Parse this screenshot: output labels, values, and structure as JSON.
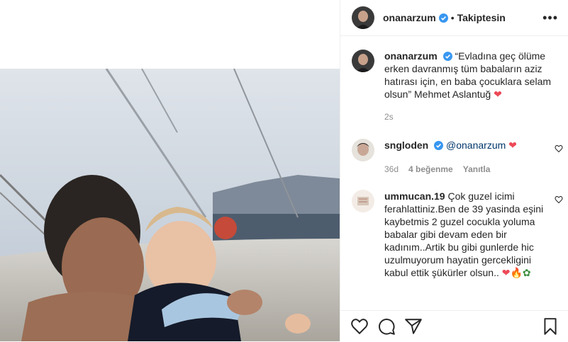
{
  "header": {
    "username": "onanarzum",
    "separator": "•",
    "follow_label": "Takiptesin",
    "more_label": "•••"
  },
  "caption": {
    "username": "onanarzum",
    "text": "“Evladına geç ölüme erken davranmış tüm babaların aziz hatırası için, en baba çocuklara selam olsun” Mehmet Aslantuğ",
    "time": "2s"
  },
  "comments": [
    {
      "username": "sngloden",
      "text": "@onanarzum",
      "time": "36d",
      "likes": "4 beğenme",
      "reply": "Yanıtla"
    },
    {
      "username": "ummucan.19",
      "text": "Çok guzel icimi ferahlattiniz.Ben de 39 yasinda eşini kaybetmis 2 guzel cocukla yoluma babalar gibi devam eden bir kadınım..Artik bu gibi gunlerde hic uzulmuyorum hayatin gercekligini kabul ettik şükürler olsun.."
    }
  ],
  "colors": {
    "verified": "#3897f0",
    "heart": "#ed4956",
    "text": "#262626",
    "muted": "#8e8e8e"
  },
  "icons": [
    "verified-icon",
    "more-options-icon",
    "like-icon",
    "comment-icon",
    "share-icon",
    "save-icon",
    "comment-like-icon"
  ]
}
